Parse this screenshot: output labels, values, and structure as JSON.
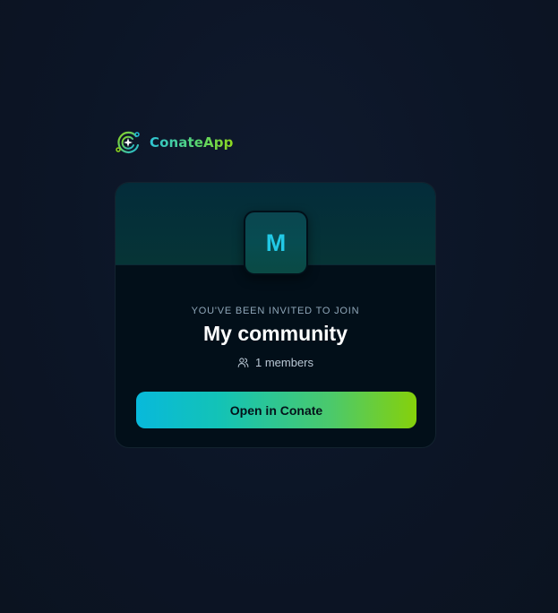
{
  "brand": {
    "name": "ConateApp",
    "logo_icon": "conate-orbit-logo-icon"
  },
  "invite": {
    "label": "YOU'VE BEEN INVITED TO JOIN",
    "community_name": "My community",
    "avatar_letter": "M",
    "members_icon": "users-icon",
    "members_text": "1 members",
    "open_button_label": "Open in Conate"
  },
  "colors": {
    "background": "#0c1526",
    "card": "#020f19",
    "banner": "#053138",
    "accent_cyan": "#08b9db",
    "accent_green": "#86d10a",
    "avatar_letter": "#22c9e6"
  }
}
